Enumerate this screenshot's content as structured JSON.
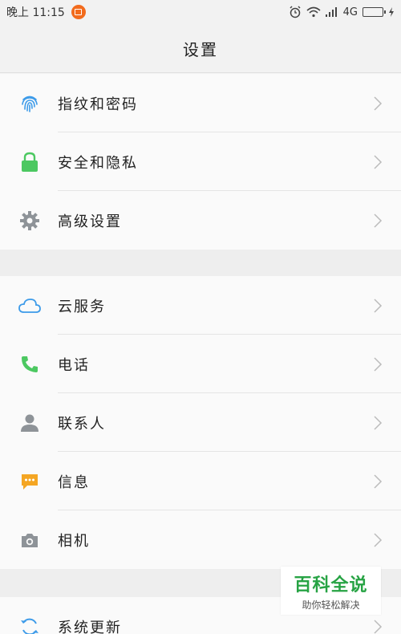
{
  "status_bar": {
    "time": "晚上 11:15",
    "network": "4G",
    "colors": {
      "notification_dot": "#f26b1d"
    }
  },
  "header": {
    "title": "设置"
  },
  "groups": [
    {
      "items": [
        {
          "label": "指纹和密码",
          "icon": "fingerprint-icon",
          "color": "#3d9be9"
        },
        {
          "label": "安全和隐私",
          "icon": "lock-icon",
          "color": "#4cc861"
        },
        {
          "label": "高级设置",
          "icon": "gear-icon",
          "color": "#8e9398"
        }
      ]
    },
    {
      "items": [
        {
          "label": "云服务",
          "icon": "cloud-icon",
          "color": "#3d9be9"
        },
        {
          "label": "电话",
          "icon": "phone-icon",
          "color": "#4cc861"
        },
        {
          "label": "联系人",
          "icon": "contact-icon",
          "color": "#8e9398"
        },
        {
          "label": "信息",
          "icon": "message-icon",
          "color": "#f4a623"
        },
        {
          "label": "相机",
          "icon": "camera-icon",
          "color": "#8e9398"
        }
      ]
    },
    {
      "items": [
        {
          "label": "系统更新",
          "icon": "sync-icon",
          "color": "#3d9be9"
        }
      ]
    }
  ],
  "watermark": {
    "title": "百科全说",
    "subtitle": "助你轻松解决"
  }
}
